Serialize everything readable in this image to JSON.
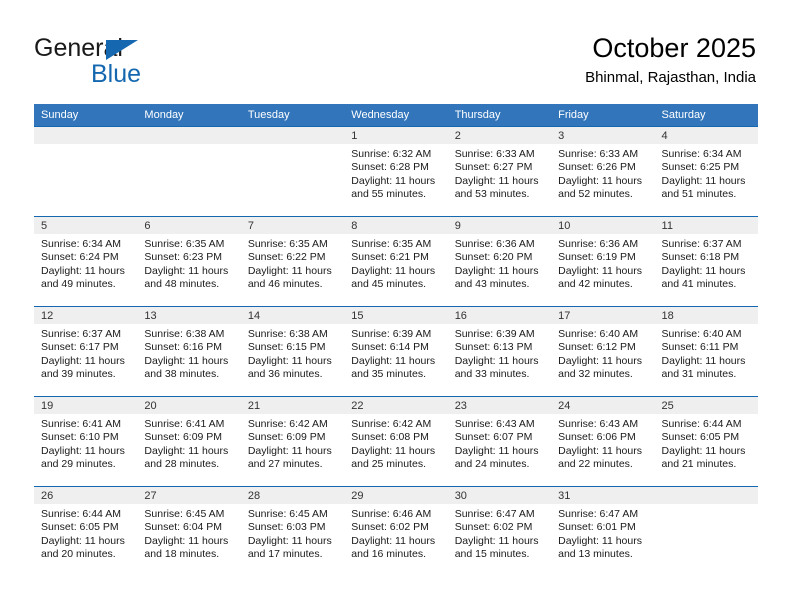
{
  "brand": {
    "name_part1": "General",
    "name_part2": "Blue",
    "accent_color": "#1568b0"
  },
  "header": {
    "title": "October 2025",
    "subtitle": "Bhinmal, Rajasthan, India"
  },
  "theme": {
    "header_row_bg": "#3275bb",
    "row_border": "#1568b0",
    "daynum_band_bg": "#efefef"
  },
  "weekday_headers": [
    "Sunday",
    "Monday",
    "Tuesday",
    "Wednesday",
    "Thursday",
    "Friday",
    "Saturday"
  ],
  "labels": {
    "sunrise_prefix": "Sunrise:",
    "sunset_prefix": "Sunset:",
    "daylight_prefix": "Daylight:"
  },
  "weeks": [
    [
      {
        "day": "",
        "empty": true
      },
      {
        "day": "",
        "empty": true
      },
      {
        "day": "",
        "empty": true
      },
      {
        "day": "1",
        "sunrise": "Sunrise: 6:32 AM",
        "sunset": "Sunset: 6:28 PM",
        "daylight_l1": "Daylight: 11 hours",
        "daylight_l2": "and 55 minutes."
      },
      {
        "day": "2",
        "sunrise": "Sunrise: 6:33 AM",
        "sunset": "Sunset: 6:27 PM",
        "daylight_l1": "Daylight: 11 hours",
        "daylight_l2": "and 53 minutes."
      },
      {
        "day": "3",
        "sunrise": "Sunrise: 6:33 AM",
        "sunset": "Sunset: 6:26 PM",
        "daylight_l1": "Daylight: 11 hours",
        "daylight_l2": "and 52 minutes."
      },
      {
        "day": "4",
        "sunrise": "Sunrise: 6:34 AM",
        "sunset": "Sunset: 6:25 PM",
        "daylight_l1": "Daylight: 11 hours",
        "daylight_l2": "and 51 minutes."
      }
    ],
    [
      {
        "day": "5",
        "sunrise": "Sunrise: 6:34 AM",
        "sunset": "Sunset: 6:24 PM",
        "daylight_l1": "Daylight: 11 hours",
        "daylight_l2": "and 49 minutes."
      },
      {
        "day": "6",
        "sunrise": "Sunrise: 6:35 AM",
        "sunset": "Sunset: 6:23 PM",
        "daylight_l1": "Daylight: 11 hours",
        "daylight_l2": "and 48 minutes."
      },
      {
        "day": "7",
        "sunrise": "Sunrise: 6:35 AM",
        "sunset": "Sunset: 6:22 PM",
        "daylight_l1": "Daylight: 11 hours",
        "daylight_l2": "and 46 minutes."
      },
      {
        "day": "8",
        "sunrise": "Sunrise: 6:35 AM",
        "sunset": "Sunset: 6:21 PM",
        "daylight_l1": "Daylight: 11 hours",
        "daylight_l2": "and 45 minutes."
      },
      {
        "day": "9",
        "sunrise": "Sunrise: 6:36 AM",
        "sunset": "Sunset: 6:20 PM",
        "daylight_l1": "Daylight: 11 hours",
        "daylight_l2": "and 43 minutes."
      },
      {
        "day": "10",
        "sunrise": "Sunrise: 6:36 AM",
        "sunset": "Sunset: 6:19 PM",
        "daylight_l1": "Daylight: 11 hours",
        "daylight_l2": "and 42 minutes."
      },
      {
        "day": "11",
        "sunrise": "Sunrise: 6:37 AM",
        "sunset": "Sunset: 6:18 PM",
        "daylight_l1": "Daylight: 11 hours",
        "daylight_l2": "and 41 minutes."
      }
    ],
    [
      {
        "day": "12",
        "sunrise": "Sunrise: 6:37 AM",
        "sunset": "Sunset: 6:17 PM",
        "daylight_l1": "Daylight: 11 hours",
        "daylight_l2": "and 39 minutes."
      },
      {
        "day": "13",
        "sunrise": "Sunrise: 6:38 AM",
        "sunset": "Sunset: 6:16 PM",
        "daylight_l1": "Daylight: 11 hours",
        "daylight_l2": "and 38 minutes."
      },
      {
        "day": "14",
        "sunrise": "Sunrise: 6:38 AM",
        "sunset": "Sunset: 6:15 PM",
        "daylight_l1": "Daylight: 11 hours",
        "daylight_l2": "and 36 minutes."
      },
      {
        "day": "15",
        "sunrise": "Sunrise: 6:39 AM",
        "sunset": "Sunset: 6:14 PM",
        "daylight_l1": "Daylight: 11 hours",
        "daylight_l2": "and 35 minutes."
      },
      {
        "day": "16",
        "sunrise": "Sunrise: 6:39 AM",
        "sunset": "Sunset: 6:13 PM",
        "daylight_l1": "Daylight: 11 hours",
        "daylight_l2": "and 33 minutes."
      },
      {
        "day": "17",
        "sunrise": "Sunrise: 6:40 AM",
        "sunset": "Sunset: 6:12 PM",
        "daylight_l1": "Daylight: 11 hours",
        "daylight_l2": "and 32 minutes."
      },
      {
        "day": "18",
        "sunrise": "Sunrise: 6:40 AM",
        "sunset": "Sunset: 6:11 PM",
        "daylight_l1": "Daylight: 11 hours",
        "daylight_l2": "and 31 minutes."
      }
    ],
    [
      {
        "day": "19",
        "sunrise": "Sunrise: 6:41 AM",
        "sunset": "Sunset: 6:10 PM",
        "daylight_l1": "Daylight: 11 hours",
        "daylight_l2": "and 29 minutes."
      },
      {
        "day": "20",
        "sunrise": "Sunrise: 6:41 AM",
        "sunset": "Sunset: 6:09 PM",
        "daylight_l1": "Daylight: 11 hours",
        "daylight_l2": "and 28 minutes."
      },
      {
        "day": "21",
        "sunrise": "Sunrise: 6:42 AM",
        "sunset": "Sunset: 6:09 PM",
        "daylight_l1": "Daylight: 11 hours",
        "daylight_l2": "and 27 minutes."
      },
      {
        "day": "22",
        "sunrise": "Sunrise: 6:42 AM",
        "sunset": "Sunset: 6:08 PM",
        "daylight_l1": "Daylight: 11 hours",
        "daylight_l2": "and 25 minutes."
      },
      {
        "day": "23",
        "sunrise": "Sunrise: 6:43 AM",
        "sunset": "Sunset: 6:07 PM",
        "daylight_l1": "Daylight: 11 hours",
        "daylight_l2": "and 24 minutes."
      },
      {
        "day": "24",
        "sunrise": "Sunrise: 6:43 AM",
        "sunset": "Sunset: 6:06 PM",
        "daylight_l1": "Daylight: 11 hours",
        "daylight_l2": "and 22 minutes."
      },
      {
        "day": "25",
        "sunrise": "Sunrise: 6:44 AM",
        "sunset": "Sunset: 6:05 PM",
        "daylight_l1": "Daylight: 11 hours",
        "daylight_l2": "and 21 minutes."
      }
    ],
    [
      {
        "day": "26",
        "sunrise": "Sunrise: 6:44 AM",
        "sunset": "Sunset: 6:05 PM",
        "daylight_l1": "Daylight: 11 hours",
        "daylight_l2": "and 20 minutes."
      },
      {
        "day": "27",
        "sunrise": "Sunrise: 6:45 AM",
        "sunset": "Sunset: 6:04 PM",
        "daylight_l1": "Daylight: 11 hours",
        "daylight_l2": "and 18 minutes."
      },
      {
        "day": "28",
        "sunrise": "Sunrise: 6:45 AM",
        "sunset": "Sunset: 6:03 PM",
        "daylight_l1": "Daylight: 11 hours",
        "daylight_l2": "and 17 minutes."
      },
      {
        "day": "29",
        "sunrise": "Sunrise: 6:46 AM",
        "sunset": "Sunset: 6:02 PM",
        "daylight_l1": "Daylight: 11 hours",
        "daylight_l2": "and 16 minutes."
      },
      {
        "day": "30",
        "sunrise": "Sunrise: 6:47 AM",
        "sunset": "Sunset: 6:02 PM",
        "daylight_l1": "Daylight: 11 hours",
        "daylight_l2": "and 15 minutes."
      },
      {
        "day": "31",
        "sunrise": "Sunrise: 6:47 AM",
        "sunset": "Sunset: 6:01 PM",
        "daylight_l1": "Daylight: 11 hours",
        "daylight_l2": "and 13 minutes."
      },
      {
        "day": "",
        "empty": true
      }
    ]
  ]
}
